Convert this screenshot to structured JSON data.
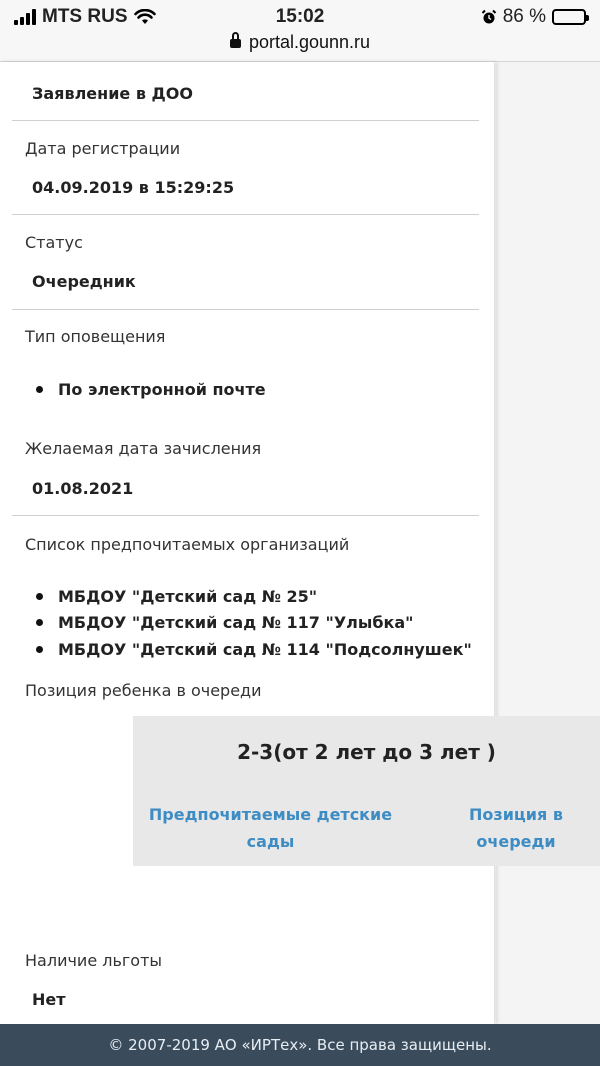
{
  "status_bar": {
    "carrier": "MTS RUS",
    "time": "15:02",
    "battery": "86 %",
    "battery_level": 0.86,
    "url": "portal.gounn.ru"
  },
  "application": {
    "title": "Заявление в ДОО",
    "registration_date_label": "Дата регистрации",
    "registration_date": "04.09.2019 в 15:29:25",
    "status_label": "Статус",
    "status": "Очередник",
    "notification_label": "Тип оповещения",
    "notification_items": [
      "По электронной почте"
    ],
    "enrollment_date_label": "Желаемая дата зачисления",
    "enrollment_date": "01.08.2021",
    "organizations_label": "Список предпочитаемых организаций",
    "organizations": [
      "МБДОУ \"Детский сад № 25\"",
      "МБДОУ \"Детский сад № 117 \"Улыбка\"",
      "МБДОУ \"Детский сад № 114 \"Подсолнушек\""
    ],
    "queue_position_label": "Позиция ребенка в очереди",
    "benefit_label": "Наличие льготы",
    "benefit": "Нет"
  },
  "queue_card": {
    "group": "2-3(от 2 лет до 3 лет )",
    "col1": "Предпочитаемые детские сады",
    "col2": "Позиция в очереди"
  },
  "footer": {
    "text": "© 2007-2019 АО «ИРТех». Все права защищены."
  },
  "icons": [
    "signal-icon",
    "wifi-icon",
    "lock-icon",
    "alarm-icon",
    "battery-icon"
  ]
}
